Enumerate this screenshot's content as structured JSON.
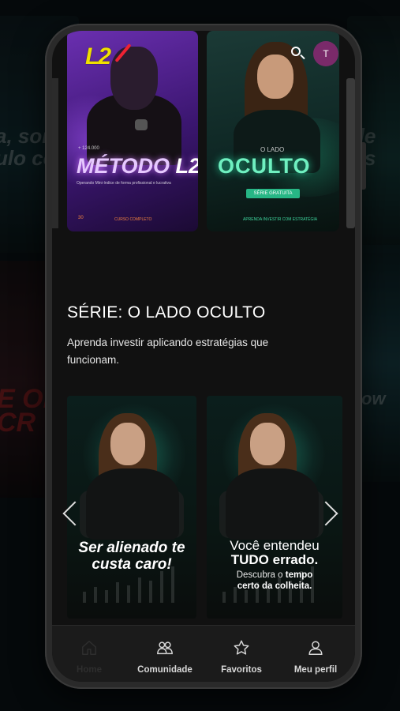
{
  "header": {
    "logo_text": "L2",
    "avatar_initial": "T"
  },
  "posters": [
    {
      "count": "+ 124.000",
      "title_main": "MÉTODO ",
      "title_accent": "L2",
      "subtitle": "Operando Mini-índice de forma profissional e lucrativa",
      "foot_num": "30",
      "foot_text": "CURSO COMPLETO"
    },
    {
      "pre": "O LADO",
      "title": "OCULTO",
      "button": "SÉRIE GRATUITA",
      "foot_text": "APRENDA INVESTIR COM ESTRATÉGIA"
    }
  ],
  "backdrop": {
    "left_text": "a, son\nulo co",
    "right_text": "de\nos",
    "red_text": "E OF\nCR",
    "blue_text": "ow"
  },
  "series": {
    "title": "SÉRIE: O LADO OCULTO",
    "description": "Aprenda investir aplicando estratégias que funcionam."
  },
  "cards": [
    {
      "text": "Ser alienado te custa caro!"
    },
    {
      "line1": "Você entendeu",
      "line2": "TUDO errado.",
      "line3_pre": "Descubra o ",
      "line3_bold": "tempo",
      "line4_bold": "certo da colheita."
    }
  ],
  "nav": {
    "items": [
      {
        "label": "Home",
        "icon": "home-icon",
        "active": true
      },
      {
        "label": "Comunidade",
        "icon": "community-icon",
        "active": false
      },
      {
        "label": "Favoritos",
        "icon": "star-icon",
        "active": false
      },
      {
        "label": "Meu perfil",
        "icon": "user-icon",
        "active": false
      }
    ]
  },
  "colors": {
    "accent_purple": "#6a2fb0",
    "accent_green": "#27b685",
    "avatar": "#7a2a6a",
    "logo_yellow": "#f0e000"
  }
}
